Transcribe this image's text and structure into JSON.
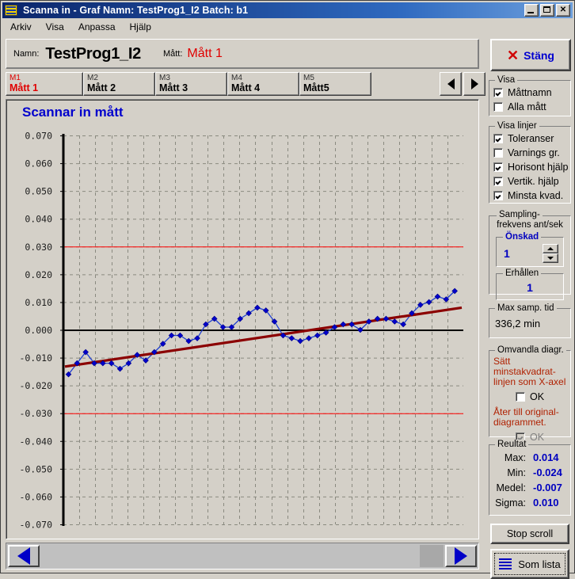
{
  "window": {
    "title": "Scanna in - Graf   Namn: TestProg1_I2   Batch: b1",
    "icon": "flag-icon",
    "minimize": "_",
    "maximize": "□",
    "close": "✕"
  },
  "menubar": {
    "items": [
      "Arkiv",
      "Visa",
      "Anpassa",
      "Hjälp"
    ]
  },
  "header": {
    "name_label": "Namn:",
    "name_value": "TestProg1_I2",
    "matt_label": "Mått:",
    "matt_value": "Mått 1"
  },
  "tabs": {
    "items": [
      {
        "id": "M1",
        "label": "Mått 1",
        "selected": true
      },
      {
        "id": "M2",
        "label": "Mått 2",
        "selected": false
      },
      {
        "id": "M3",
        "label": "Mått 3",
        "selected": false
      },
      {
        "id": "M4",
        "label": "Mått 4",
        "selected": false
      },
      {
        "id": "M5",
        "label": "Mått5",
        "selected": false
      }
    ],
    "prev_icon": "triangle-left-icon",
    "next_icon": "triangle-right-icon"
  },
  "graph": {
    "title": "Scannar in mått"
  },
  "chart_data": {
    "type": "line",
    "title": "Scannar in mått",
    "xlabel": "",
    "ylabel": "",
    "ylim": [
      -0.07,
      0.07
    ],
    "yticks": [
      "0.070",
      "0.060",
      "0.050",
      "0.040",
      "0.030",
      "0.020",
      "0.010",
      "0.000",
      "-0.010",
      "-0.020",
      "-0.030",
      "-0.040",
      "-0.050",
      "-0.060",
      "-0.070"
    ],
    "grid": true,
    "legend": "none",
    "reference_lines": [
      {
        "name": "upper-tolerance",
        "value": 0.03,
        "color": "#ff0000"
      },
      {
        "name": "lower-tolerance",
        "value": -0.03,
        "color": "#ff0000"
      },
      {
        "name": "zero-axis",
        "value": 0.0,
        "color": "#000000"
      }
    ],
    "series": [
      {
        "name": "Mått 1",
        "color": "#2040d0",
        "marker": "diamond",
        "marker_color": "#0000cd",
        "values": [
          -0.016,
          -0.012,
          -0.008,
          -0.012,
          -0.012,
          -0.012,
          -0.014,
          -0.012,
          -0.009,
          -0.011,
          -0.008,
          -0.005,
          -0.002,
          -0.002,
          -0.004,
          -0.003,
          0.002,
          0.004,
          0.001,
          0.001,
          0.004,
          0.006,
          0.008,
          0.007,
          0.003,
          -0.002,
          -0.003,
          -0.004,
          -0.003,
          -0.002,
          -0.001,
          0.001,
          0.002,
          0.002,
          0.0,
          0.003,
          0.004,
          0.004,
          0.003,
          0.002,
          0.006,
          0.009,
          0.01,
          0.012,
          0.011,
          0.014
        ]
      },
      {
        "name": "Minsta kvadrat",
        "color": "#8b0000",
        "type": "trend",
        "y_start": -0.0132,
        "y_end": 0.008
      }
    ]
  },
  "scrollbar": {
    "left_icon": "triangle-left-icon",
    "right_icon": "triangle-right-icon"
  },
  "sidebar": {
    "close_button": {
      "label": "Stäng",
      "icon": "x-icon"
    },
    "visa_group": {
      "title": "Visa",
      "items": [
        {
          "label": "Måttnamn",
          "checked": true
        },
        {
          "label": "Alla mått",
          "checked": false
        }
      ]
    },
    "visa_linjer_group": {
      "title": "Visa linjer",
      "items": [
        {
          "label": "Toleranser",
          "checked": true
        },
        {
          "label": "Varnings gr.",
          "checked": false
        },
        {
          "label": "Horisont hjälp",
          "checked": true
        },
        {
          "label": "Vertik. hjälp",
          "checked": true
        },
        {
          "label": "Minsta kvad.",
          "checked": true
        }
      ]
    },
    "sampling_group": {
      "title_line1": "Sampling-",
      "title_line2": "frekvens ant/sek",
      "onskad": {
        "title": "Önskad",
        "value": "1",
        "spinner_up": "▲",
        "spinner_down": "▼"
      },
      "erhallen": {
        "title": "Erhållen",
        "value": "1"
      }
    },
    "max_samp": {
      "title": "Max samp. tid",
      "value": "336,2 min"
    },
    "omvandla": {
      "title": "Omvandla diagr.",
      "text1_line1": "Sätt minstakvadrat-",
      "text1_line2": "linjen som X-axel",
      "ok1": {
        "label": "OK",
        "checked": false,
        "disabled": false
      },
      "text2_line1": "Åter till original-",
      "text2_line2": "diagrammet.",
      "ok2": {
        "label": "OK",
        "checked": true,
        "disabled": true
      }
    },
    "result": {
      "title": "Reultat",
      "rows": [
        {
          "key": "Max:",
          "value": "0.014"
        },
        {
          "key": "Min:",
          "value": "-0.024"
        },
        {
          "key": "Medel:",
          "value": "-0.007"
        },
        {
          "key": "Sigma:",
          "value": "0.010"
        }
      ]
    },
    "stop_scroll": {
      "label": "Stop scroll"
    },
    "som_lista": {
      "label": "Som lista",
      "icon": "list-lines-icon"
    }
  },
  "colors": {
    "face": "#d4d0c8",
    "titlebar": "#0a246a",
    "accent_blue": "#0000cd",
    "accent_red": "#e00000",
    "trend": "#8b0000"
  }
}
